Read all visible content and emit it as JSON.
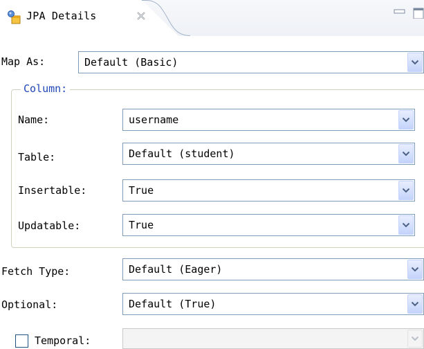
{
  "tab": {
    "title": "JPA Details",
    "icon": "jpa-details-icon",
    "close_icon": "close-icon"
  },
  "view_controls": {
    "minimize_icon": "minimize-icon",
    "maximize_icon": "maximize-icon"
  },
  "map_as": {
    "label": "Map As:",
    "value": "Default (Basic)"
  },
  "column": {
    "legend": "Column:",
    "name": {
      "label": "Name:",
      "value": "username"
    },
    "table": {
      "label": "Table:",
      "value": "Default (student)"
    },
    "insertable": {
      "label": "Insertable:",
      "value": "True"
    },
    "updatable": {
      "label": "Updatable:",
      "value": "True"
    }
  },
  "fetch_type": {
    "label": "Fetch Type:",
    "value": "Default (Eager)"
  },
  "optional": {
    "label": "Optional:",
    "value": "Default (True)"
  },
  "temporal": {
    "label": "Temporal:",
    "checked": false,
    "value": ""
  },
  "colors": {
    "group_title": "#2046b8",
    "field_border": "#7f9db9",
    "arrow": "#4d6185"
  }
}
